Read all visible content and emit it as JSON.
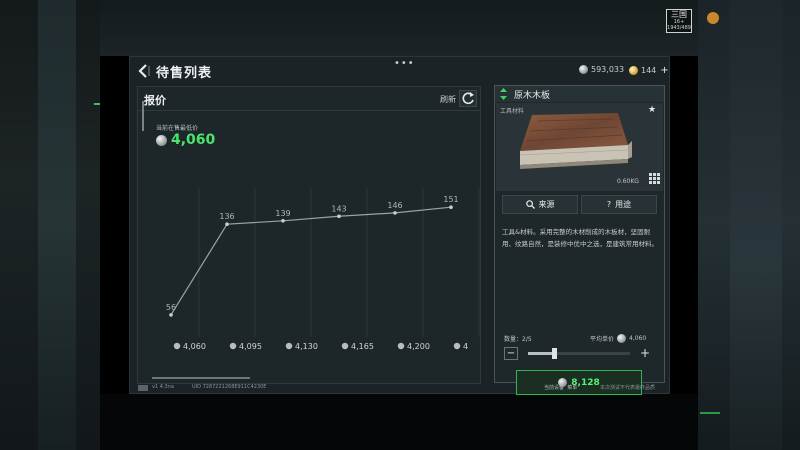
{
  "header": {
    "title": "待售列表",
    "more": "•••",
    "currency_silver": "593,033",
    "currency_gold": "144",
    "add": "+"
  },
  "rating": {
    "top": "三国",
    "bottom": "16+ 1943/489"
  },
  "quote": {
    "title": "报价",
    "refresh_label": "刷新",
    "lowest_label": "当前在售最低价",
    "lowest_value": "4,060"
  },
  "chart_data": {
    "type": "line",
    "categories": [
      "4,060",
      "4,095",
      "4,130",
      "4,165",
      "4,200",
      "4"
    ],
    "values": [
      56,
      136,
      139,
      143,
      146,
      151
    ],
    "title": "",
    "xlabel": "",
    "ylabel": "",
    "grid": true
  },
  "item": {
    "name": "原木木板",
    "category": "工具材料",
    "weight": "0.60KG",
    "source_label": "来源",
    "use_label": "用途",
    "description": "工具&材料。采用完整的木材削成的木板材，坚固耐用、纹路自然，是装修中优中之选，是建筑常用材料。",
    "qty_label": "数量：2/5",
    "unit_price_label": "平均单价",
    "unit_price": "4,060",
    "qty_fraction": 0.25,
    "buy_total": "8,128",
    "minus": "−",
    "plus": "+"
  },
  "footer": {
    "version": "v1 4.3na",
    "uid": "UID 7287221268E911C4230E",
    "link1": "当前设备",
    "link2": "菜单",
    "notice": "本次测试不代表最终品质"
  },
  "colors": {
    "accent_green": "#4be56b",
    "panel": "#1b2326"
  }
}
